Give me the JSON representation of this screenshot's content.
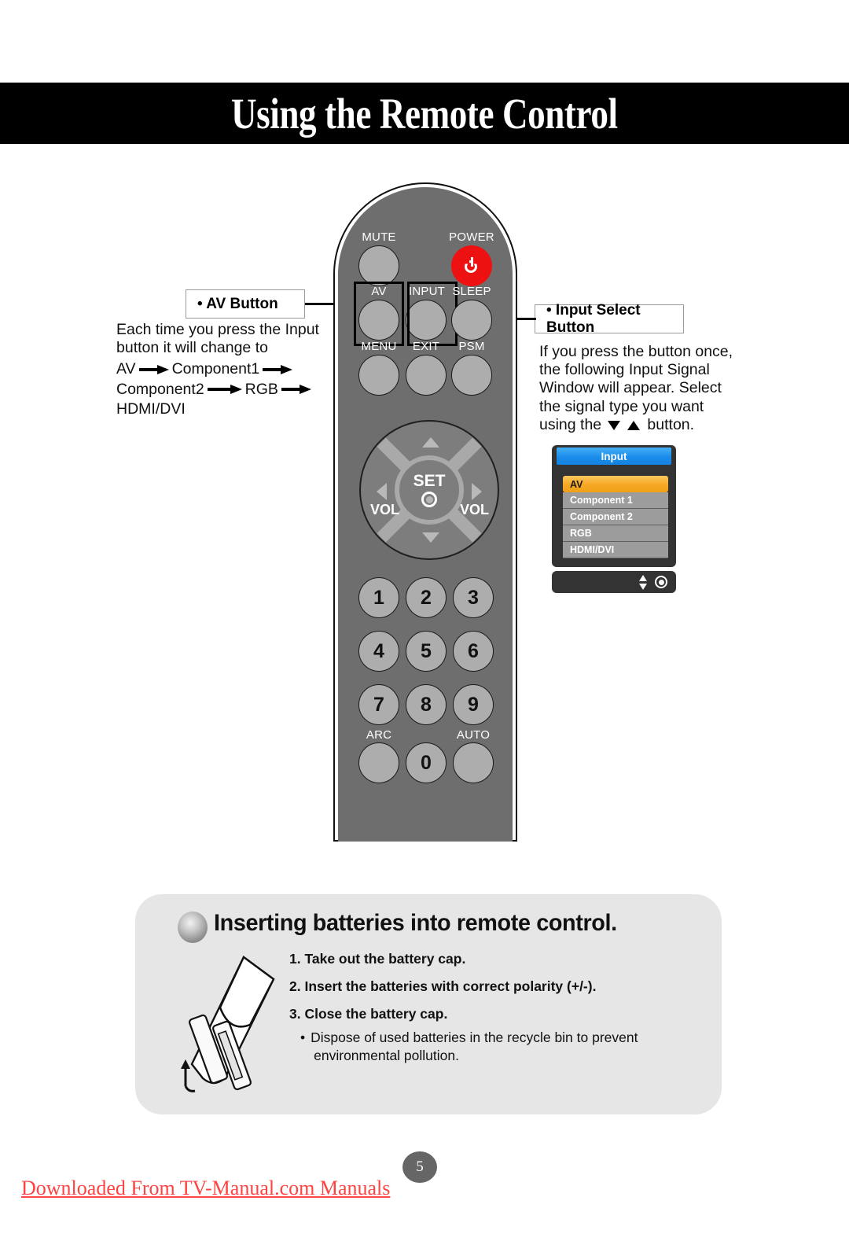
{
  "header": {
    "title": "Using the Remote Control"
  },
  "remote": {
    "top_labels": {
      "mute": "MUTE",
      "power": "POWER",
      "av": "AV",
      "input": "INPUT",
      "sleep": "SLEEP",
      "menu": "MENU",
      "exit": "EXIT",
      "psm": "PSM"
    },
    "navpad": {
      "set_label": "SET",
      "vol_left": "VOL",
      "vol_right": "VOL",
      "up_icon": "triangle-up-icon",
      "down_icon": "triangle-down-icon",
      "left_icon": "triangle-left-icon",
      "right_icon": "triangle-right-icon",
      "set_icon": "set-ring-icon"
    },
    "keypad": {
      "row1": [
        "1",
        "2",
        "3"
      ],
      "row2": [
        "4",
        "5",
        "6"
      ],
      "row3": [
        "7",
        "8",
        "9"
      ],
      "row4": [
        "",
        "0",
        ""
      ],
      "arc_label": "ARC",
      "auto_label": "AUTO"
    },
    "power_icon": "power-icon",
    "highlight_boxes": [
      "av",
      "input"
    ]
  },
  "callout_av": {
    "title": "• AV Button",
    "line1": "Each time you press the Input",
    "line2": "button it will change to",
    "flow": [
      "AV",
      "Component1",
      "Component2",
      "RGB",
      "HDMI/DVI"
    ],
    "arrow_icon": "arrow-right-icon"
  },
  "callout_input": {
    "title": "• Input Select Button",
    "line1": "If you press the button once,",
    "line2": "the following Input Signal",
    "line3": "Window will appear. Select",
    "line4": "the signal type you want",
    "line5_prefix": "using the",
    "line5_suffix": "button.",
    "down_icon": "triangle-down-icon",
    "up_icon": "triangle-up-icon"
  },
  "osd": {
    "title": "Input",
    "items": [
      {
        "label": "AV",
        "selected": true
      },
      {
        "label": "Component 1",
        "selected": false
      },
      {
        "label": "Component 2",
        "selected": false
      },
      {
        "label": "RGB",
        "selected": false
      },
      {
        "label": "HDMI/DVI",
        "selected": false
      }
    ],
    "footer_icons": [
      "up-down-arrow-icon",
      "set-ring-icon"
    ],
    "colors": {
      "title_bar": "#1a8cec",
      "selected_row": "#f7a927",
      "row": "#9c9c9c",
      "body": "#333333"
    }
  },
  "battery": {
    "heading": "Inserting batteries into remote control.",
    "bullet_icon": "sphere-bullet-icon",
    "steps": [
      "1. Take out the battery cap.",
      "2. Insert the batteries with correct polarity (+/-).",
      "3. Close the battery cap."
    ],
    "note_bullet": "•",
    "note_line1": "Dispose of used batteries in the recycle bin to prevent",
    "note_line2": "environmental pollution.",
    "illustration": "remote-battery-cap-diagram"
  },
  "footer": {
    "page_number": "5",
    "watermark": "Downloaded From TV-Manual.com Manuals",
    "watermark_color": "#ff4242"
  }
}
